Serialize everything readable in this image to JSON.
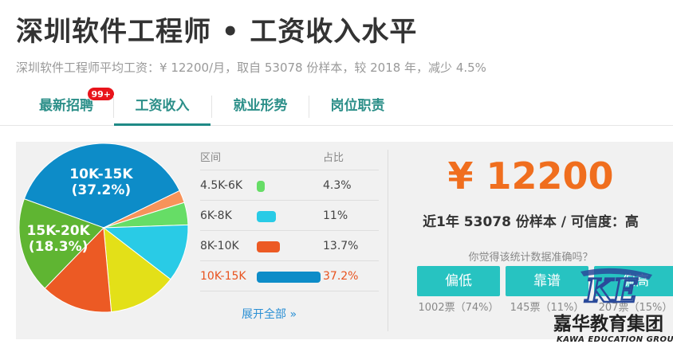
{
  "page": {
    "title": "深圳软件工程师 • 工资收入水平",
    "subtitle": "深圳软件工程师平均工资：¥ 12200/月，取自 53078 份样本，较 2018 年，减少 4.5%"
  },
  "tabs": [
    {
      "label": "最新招聘",
      "badge": "99+",
      "active": false
    },
    {
      "label": "工资收入",
      "active": true
    },
    {
      "label": "就业形势",
      "active": false
    },
    {
      "label": "岗位职责",
      "active": false
    }
  ],
  "table": {
    "header_range": "区间",
    "header_pct": "占比",
    "rows": [
      {
        "range": "4.5K-6K",
        "pct": "4.3%",
        "value": 4.3,
        "color": "#66dd66"
      },
      {
        "range": "6K-8K",
        "pct": "11%",
        "value": 11,
        "color": "#29cbe6"
      },
      {
        "range": "8K-10K",
        "pct": "13.7%",
        "value": 13.7,
        "color": "#ec5a24"
      },
      {
        "range": "10K-15K",
        "pct": "37.2%",
        "value": 37.2,
        "color": "#0d8cc8"
      }
    ],
    "expand_label": "展开全部 »"
  },
  "chart_data": {
    "type": "pie",
    "slices": [
      {
        "label": "10K-15K",
        "value": 37.2,
        "color": "#0d8cc8",
        "text": "10K-15K",
        "pct_text": "(37.2%)"
      },
      {
        "label": "",
        "value": 2.4,
        "color": "#f7935a"
      },
      {
        "label": "4.5K-6K",
        "value": 4.3,
        "color": "#66dd66"
      },
      {
        "label": "6K-8K",
        "value": 11,
        "color": "#29cbe6"
      },
      {
        "label": "",
        "value": 13.1,
        "color": "#e3e018"
      },
      {
        "label": "8K-10K",
        "value": 13.7,
        "color": "#ec5a24"
      },
      {
        "label": "15K-20K",
        "value": 18.3,
        "color": "#5fb532",
        "text": "15K-20K",
        "pct_text": "(18.3%)"
      }
    ]
  },
  "summary": {
    "salary": "¥ 12200",
    "sample_line": "近1年 53078 份样本 / 可信度：高",
    "question": "你觉得该统计数据准确吗？",
    "votes": [
      {
        "label": "偏低",
        "count": "1002票（74%）"
      },
      {
        "label": "靠谱",
        "count": "145票（11%）"
      },
      {
        "label": "偏高",
        "count": "207票（15%）"
      }
    ]
  },
  "watermark": {
    "cn": "嘉华教育集团",
    "en": "KAWA EDUCATION GROUP",
    "mark": "KE"
  },
  "colors": {
    "accent_teal": "#1f8a86",
    "salary_orange": "#f06e1e",
    "vote_button": "#27c3c1",
    "highlight_row": "#e8531f"
  }
}
